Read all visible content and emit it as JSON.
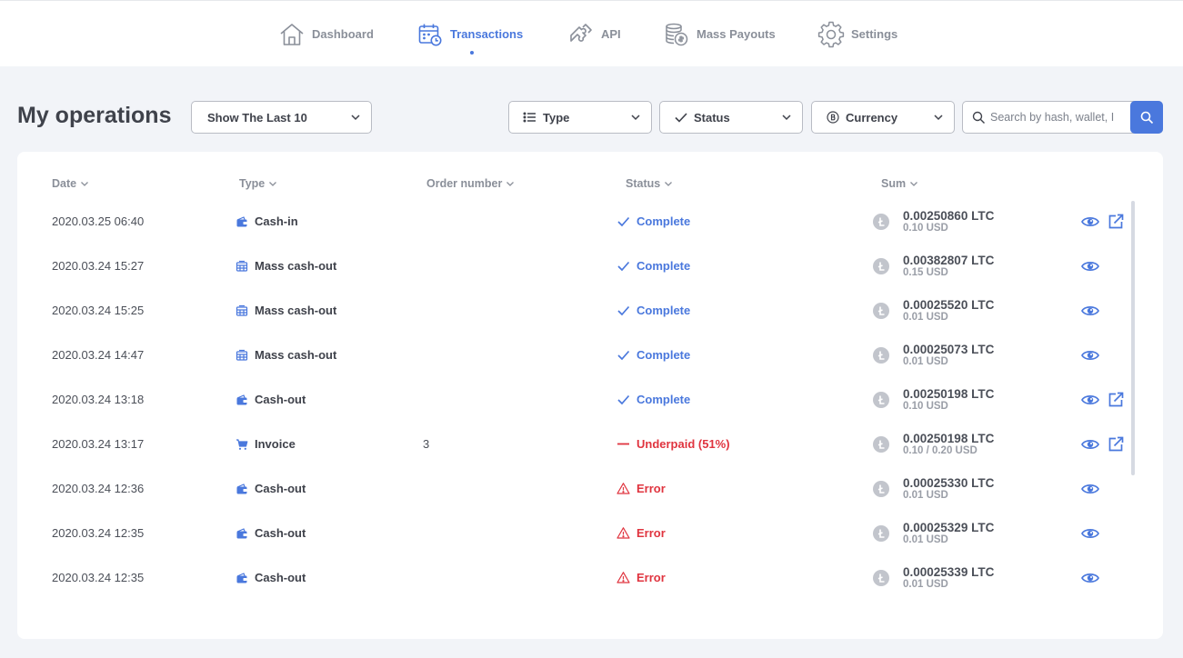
{
  "nav": {
    "items": [
      {
        "label": "Dashboard",
        "icon": "house-icon",
        "active": false
      },
      {
        "label": "Transactions",
        "icon": "calendar-clock-icon",
        "active": true
      },
      {
        "label": "API",
        "icon": "puzzle-icon",
        "active": false
      },
      {
        "label": "Mass Payouts",
        "icon": "coins-stack-icon",
        "active": false
      },
      {
        "label": "Settings",
        "icon": "gear-icon",
        "active": false
      }
    ]
  },
  "page": {
    "title": "My operations"
  },
  "filters": {
    "period": "Show The Last 10",
    "type": "Type",
    "status": "Status",
    "currency": "Currency"
  },
  "search": {
    "placeholder": "Search by hash, wallet, I"
  },
  "table": {
    "headers": {
      "date": "Date",
      "type": "Type",
      "order": "Order number",
      "status": "Status",
      "sum": "Sum"
    },
    "rows": [
      {
        "date": "2020.03.25 06:40",
        "type": "Cash-in",
        "type_icon": "wallet-icon",
        "order": "",
        "status": "Complete",
        "status_kind": "complete",
        "crypto": "0.00250860 LTC",
        "fiat": "0.10 USD",
        "link": true
      },
      {
        "date": "2020.03.24 15:27",
        "type": "Mass cash-out",
        "type_icon": "mass-payout-icon",
        "order": "",
        "status": "Complete",
        "status_kind": "complete",
        "crypto": "0.00382807 LTC",
        "fiat": "0.15 USD",
        "link": false
      },
      {
        "date": "2020.03.24 15:25",
        "type": "Mass cash-out",
        "type_icon": "mass-payout-icon",
        "order": "",
        "status": "Complete",
        "status_kind": "complete",
        "crypto": "0.00025520 LTC",
        "fiat": "0.01 USD",
        "link": false
      },
      {
        "date": "2020.03.24 14:47",
        "type": "Mass cash-out",
        "type_icon": "mass-payout-icon",
        "order": "",
        "status": "Complete",
        "status_kind": "complete",
        "crypto": "0.00025073 LTC",
        "fiat": "0.01 USD",
        "link": false
      },
      {
        "date": "2020.03.24 13:18",
        "type": "Cash-out",
        "type_icon": "wallet-icon",
        "order": "",
        "status": "Complete",
        "status_kind": "complete",
        "crypto": "0.00250198 LTC",
        "fiat": "0.10 USD",
        "link": true
      },
      {
        "date": "2020.03.24 13:17",
        "type": "Invoice",
        "type_icon": "cart-icon",
        "order": "3",
        "status": "Underpaid (51%)",
        "status_kind": "underpaid",
        "crypto": "0.00250198 LTC",
        "fiat": "0.10 / 0.20 USD",
        "link": true
      },
      {
        "date": "2020.03.24 12:36",
        "type": "Cash-out",
        "type_icon": "wallet-icon",
        "order": "",
        "status": "Error",
        "status_kind": "error",
        "crypto": "0.00025330 LTC",
        "fiat": "0.01 USD",
        "link": false
      },
      {
        "date": "2020.03.24 12:35",
        "type": "Cash-out",
        "type_icon": "wallet-icon",
        "order": "",
        "status": "Error",
        "status_kind": "error",
        "crypto": "0.00025329 LTC",
        "fiat": "0.01 USD",
        "link": false
      },
      {
        "date": "2020.03.24 12:35",
        "type": "Cash-out",
        "type_icon": "wallet-icon",
        "order": "",
        "status": "Error",
        "status_kind": "error",
        "crypto": "0.00025339 LTC",
        "fiat": "0.01 USD",
        "link": false
      }
    ]
  },
  "colors": {
    "accent": "#4a78dd",
    "error": "#e0343f",
    "text": "#3f424b",
    "muted": "#8a8f99",
    "background": "#f2f4f8"
  }
}
